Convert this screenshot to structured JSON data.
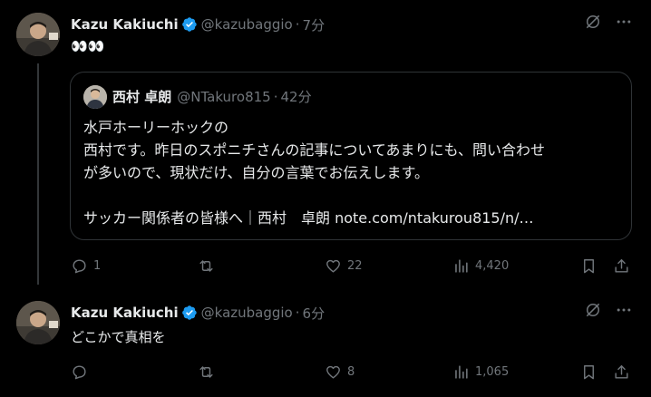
{
  "tweets": [
    {
      "author": {
        "name": "Kazu Kakiuchi",
        "handle": "@kazubaggio",
        "time": "7分"
      },
      "text": "👀👀",
      "quote": {
        "author": {
          "name": "西村 卓朗",
          "handle": "@NTakuro815",
          "time": "42分"
        },
        "lines": [
          "水戸ホーリーホックの",
          "西村です。昨日のスポニチさんの記事についてあまりにも、問い合わせ",
          "が多いので、現状だけ、自分の言葉でお伝えします。",
          "",
          "サッカー関係者の皆様へ｜西村　卓朗  note.com/ntakurou815/n/…"
        ]
      },
      "stats": {
        "replies": "1",
        "reposts": "",
        "likes": "22",
        "views": "4,420"
      }
    },
    {
      "author": {
        "name": "Kazu Kakiuchi",
        "handle": "@kazubaggio",
        "time": "6分"
      },
      "text": "どこかで真相を",
      "stats": {
        "replies": "",
        "reposts": "",
        "likes": "8",
        "views": "1,065"
      }
    }
  ],
  "separator": "·",
  "colors": {
    "verified": "#1d9bf0",
    "muted": "#71767b",
    "text": "#e7e9ea",
    "border": "#2f3336"
  },
  "icons": [
    "verified-badge-icon",
    "grok-icon",
    "more-icon",
    "reply-icon",
    "repost-icon",
    "like-icon",
    "views-icon",
    "bookmark-icon",
    "share-icon"
  ]
}
